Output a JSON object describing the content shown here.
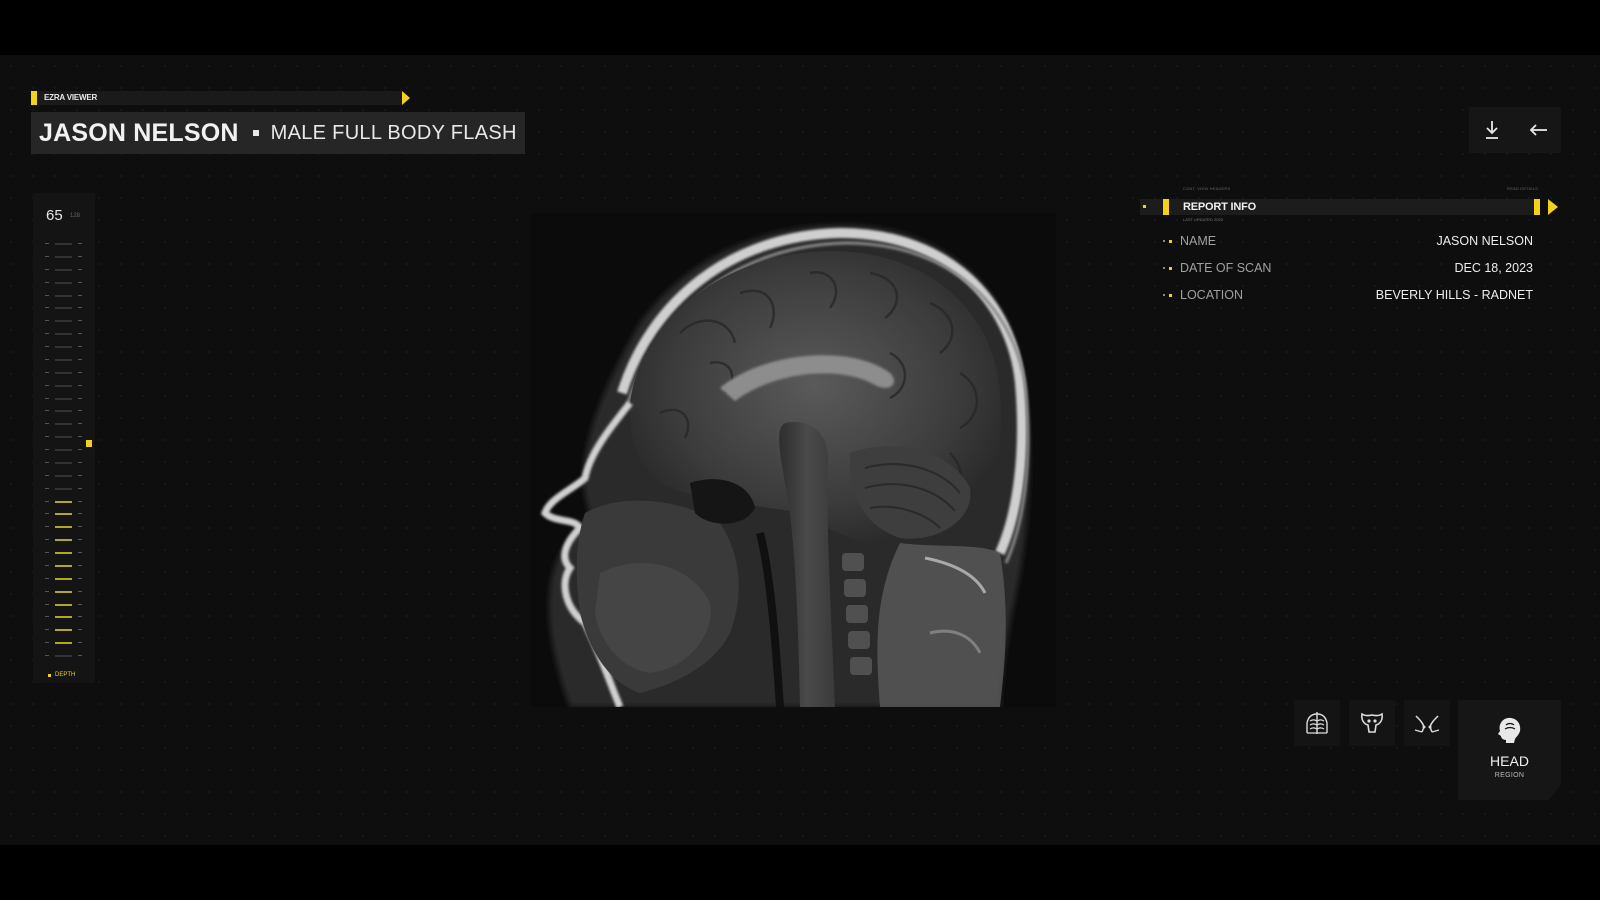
{
  "viewer": {
    "tag": "EZRA VIEWER",
    "patient_name": "JASON NELSON",
    "scan_type": "MALE FULL BODY FLASH"
  },
  "toolbar": {
    "download_icon": "download-icon",
    "back_icon": "arrow-left-icon"
  },
  "depth": {
    "value": "65",
    "max": "128",
    "label": "DEPTH",
    "level": 0.38
  },
  "scan_image": {
    "view": "sagittal head MRI"
  },
  "report": {
    "micro_left": "CONT. VIEW HEADERS",
    "micro_right": "READ DETAILS",
    "title": "REPORT INFO",
    "subtitle": "LAST UPDATED 2023",
    "rows": [
      {
        "key": "NAME",
        "value": "JASON NELSON"
      },
      {
        "key": "DATE OF SCAN",
        "value": "DEC 18, 2023"
      },
      {
        "key": "LOCATION",
        "value": "BEVERLY HILLS - RADNET"
      }
    ]
  },
  "regions": {
    "options": [
      {
        "name": "chest",
        "icon": "chest-icon"
      },
      {
        "name": "pelvis",
        "icon": "pelvis-icon"
      },
      {
        "name": "legs",
        "icon": "legs-icon"
      }
    ],
    "selected": {
      "name": "HEAD",
      "sub": "REGION",
      "icon": "head-icon"
    }
  },
  "colors": {
    "accent": "#f2d21a",
    "background": "#0e0e0e",
    "panel": "#1c1c1c"
  }
}
